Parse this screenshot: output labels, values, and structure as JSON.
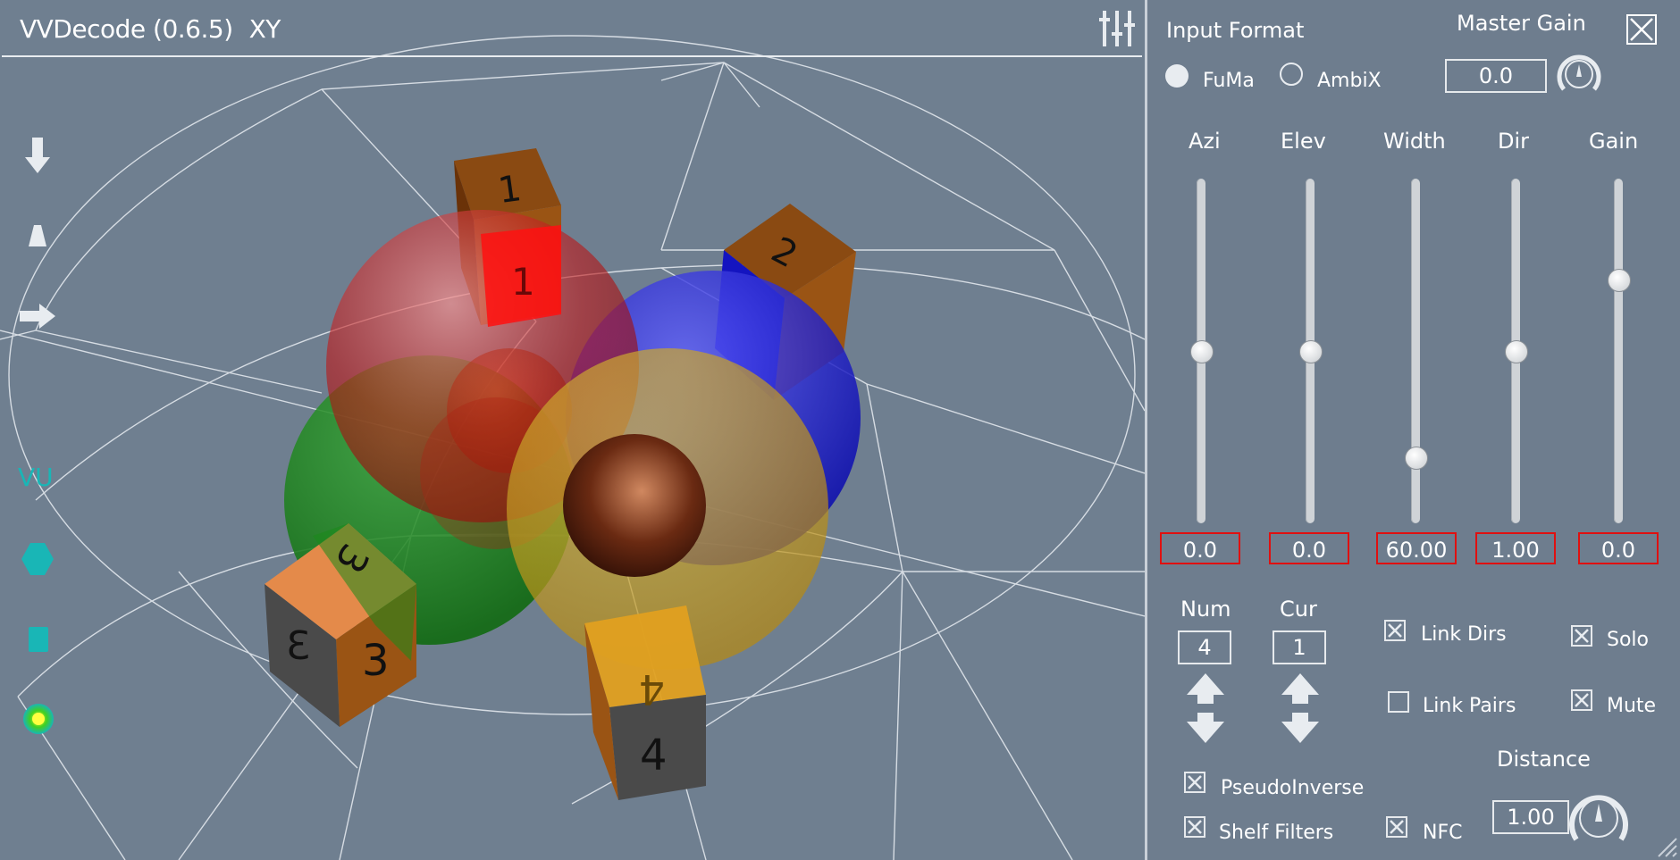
{
  "app": {
    "title": "VVDecode (0.6.5)",
    "view": "XY"
  },
  "viewport": {
    "toolbar_icons": [
      "arrow-down-icon",
      "cone-icon",
      "arrow-right-icon",
      "vu-text-icon",
      "hexagon-icon",
      "square-icon",
      "sun-icon"
    ],
    "vu_label": "VU",
    "cube_labels": [
      "1",
      "2",
      "3",
      "4"
    ],
    "colors": {
      "speaker1": "#e01010",
      "speaker2": "#1010d8",
      "speaker3": "#1a8a1a",
      "speaker4": "#d4a010",
      "cube": "#9a5414",
      "accent": "#19b6b6"
    }
  },
  "panel": {
    "input_format": {
      "label": "Input Format",
      "options": [
        "FuMa",
        "AmbiX"
      ],
      "selected": "FuMa"
    },
    "master_gain": {
      "label": "Master Gain",
      "value": "0.0"
    },
    "sliders": [
      {
        "label": "Azi",
        "value": "0.0",
        "level": 0.5
      },
      {
        "label": "Elev",
        "value": "0.0",
        "level": 0.5
      },
      {
        "label": "Width",
        "value": "60.00",
        "level": 0.17
      },
      {
        "label": "Dir",
        "value": "1.00",
        "level": 0.5
      },
      {
        "label": "Gain",
        "value": "0.0",
        "level": 0.72
      }
    ],
    "num": {
      "label": "Num",
      "value": "4"
    },
    "cur": {
      "label": "Cur",
      "value": "1"
    },
    "checkboxes": {
      "link_dirs": {
        "label": "Link Dirs",
        "checked": true
      },
      "solo": {
        "label": "Solo",
        "checked": true
      },
      "link_pairs": {
        "label": "Link Pairs",
        "checked": false
      },
      "mute": {
        "label": "Mute",
        "checked": true
      },
      "pseudo_inverse": {
        "label": "PseudoInverse",
        "checked": true
      },
      "shelf_filters": {
        "label": "Shelf Filters",
        "checked": true
      },
      "nfc": {
        "label": "NFC",
        "checked": true
      }
    },
    "distance": {
      "label": "Distance",
      "value": "1.00"
    }
  }
}
